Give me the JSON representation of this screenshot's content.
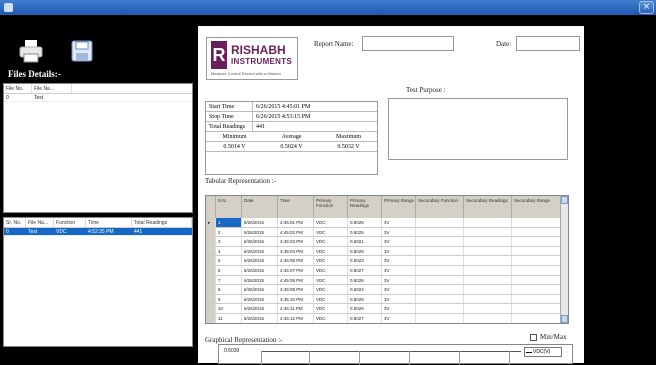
{
  "window": {
    "close_glyph": "×"
  },
  "toolbar": {
    "print_icon": "printer-icon",
    "save_icon": "save-icon"
  },
  "files": {
    "title": "Files Details:-",
    "grid1": {
      "headers": [
        "File No.",
        "File Na..."
      ],
      "rows": [
        [
          "0",
          "Test"
        ]
      ]
    },
    "grid2": {
      "headers": [
        "Sr. No.",
        "File Na...",
        "Function",
        "Time",
        "Total Readings"
      ],
      "rows": [
        [
          "0",
          "Test",
          "VDC",
          "4:52:25 PM",
          "441"
        ]
      ]
    }
  },
  "report": {
    "logo": {
      "mark": "R",
      "line1": "RISHABH",
      "line2": "INSTRUMENTS",
      "tagline": "Measure Control Record with a Mission"
    },
    "report_name_label": "Report Name:",
    "date_label": "Date:",
    "test_purpose_label": "Test Purpose :",
    "info": {
      "start_label": "Start Time",
      "start_value": "6/26/2015 4:45:01 PM",
      "stop_label": "Stop Time",
      "stop_value": "6/26/2015 4:53:15 PM",
      "total_label": "Total Readings",
      "total_value": "441",
      "min_label": "Minimum",
      "avg_label": "Average",
      "max_label": "Maximum",
      "min_value": "0.5014 V",
      "avg_value": "0.5024 V",
      "max_value": "0.5032 V"
    },
    "tabular_label": "Tabular Representation :-",
    "table": {
      "headers": [
        "S.N.",
        "Date",
        "Time",
        "Primary Function",
        "Primary Readings",
        "Primary Range",
        "Secondary Function",
        "Secondary Readings",
        "Secondary Range"
      ],
      "rows": [
        [
          "1",
          "6/26/2015",
          "4:45:01 PM",
          "VDC",
          "0.5026",
          "3V",
          "",
          "",
          ""
        ],
        [
          "2",
          "6/26/2015",
          "4:45:02 PM",
          "VDC",
          "0.5025",
          "3V",
          "",
          "",
          ""
        ],
        [
          "3",
          "6/26/2015",
          "4:45:03 PM",
          "VDC",
          "0.5021",
          "3V",
          "",
          "",
          ""
        ],
        [
          "4",
          "6/26/2015",
          "4:45:04 PM",
          "VDC",
          "0.5026",
          "3V",
          "",
          "",
          ""
        ],
        [
          "5",
          "6/26/2015",
          "4:45:05 PM",
          "VDC",
          "0.5023",
          "3V",
          "",
          "",
          ""
        ],
        [
          "6",
          "6/26/2015",
          "4:45:07 PM",
          "VDC",
          "0.5027",
          "3V",
          "",
          "",
          ""
        ],
        [
          "7",
          "6/26/2015",
          "4:45:08 PM",
          "VDC",
          "0.5026",
          "3V",
          "",
          "",
          ""
        ],
        [
          "8",
          "6/26/2015",
          "4:45:09 PM",
          "VDC",
          "0.5024",
          "3V",
          "",
          "",
          ""
        ],
        [
          "9",
          "6/26/2015",
          "4:45:10 PM",
          "VDC",
          "0.5026",
          "3V",
          "",
          "",
          ""
        ],
        [
          "10",
          "6/26/2015",
          "4:45:11 PM",
          "VDC",
          "0.5026",
          "3V",
          "",
          "",
          ""
        ],
        [
          "11",
          "6/26/2015",
          "4:45:12 PM",
          "VDC",
          "0.5027",
          "3V",
          "",
          "",
          ""
        ]
      ]
    },
    "graph_label": "Graphical Representation :-",
    "minmax_label": "Min/Max",
    "chart": {
      "ytick": "0.5030",
      "legend": "VDC(V)"
    }
  }
}
